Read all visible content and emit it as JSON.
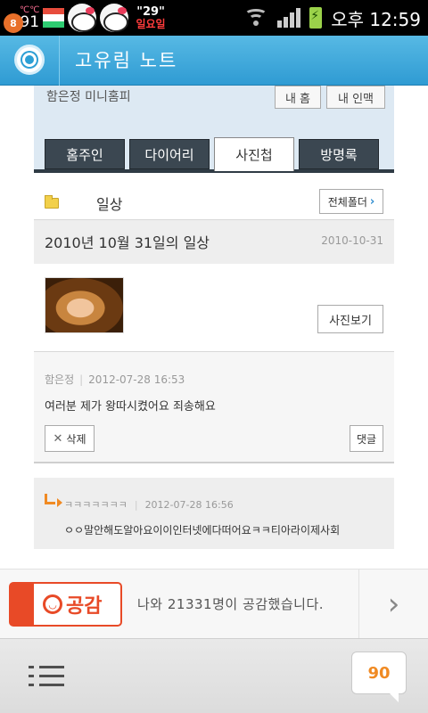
{
  "status_bar": {
    "badge_count": "8",
    "temp_small": "℃℃",
    "temp_value": "91",
    "weather_deg": "\"29\"",
    "weather_day": "일요일",
    "time": "오후 12:59",
    "icons": [
      "notification-badge-icon",
      "hello-kitty-icon",
      "wifi-icon",
      "signal-icon",
      "battery-charging-icon"
    ]
  },
  "app_bar": {
    "title": "고유림 노트",
    "accent": "#3aa7dc"
  },
  "profile": {
    "name": "함은정 미니홈피",
    "my_home": "내 홈",
    "my_network": "내 인맥"
  },
  "tabs": [
    {
      "label": "홈주인",
      "active": false
    },
    {
      "label": "다이어리",
      "active": false
    },
    {
      "label": "사진첩",
      "active": true
    },
    {
      "label": "방명록",
      "active": false
    }
  ],
  "folder": {
    "name": "일상",
    "all_folders_label": "전체폴더"
  },
  "post": {
    "title": "2010년 10월 31일의 일상",
    "date": "2010-10-31",
    "view_photo_label": "사진보기"
  },
  "comment": {
    "author": "함은정",
    "datetime": "2012-07-28 16:53",
    "text": "여러분 제가 왕따시켰어요 죄송해요",
    "delete_label": "삭제",
    "reply_label": "댓글"
  },
  "reply": {
    "author": "ㅋㅋㅋㅋㅋㅋㅋ",
    "datetime": "2012-07-28 16:56",
    "text": "ㅇㅇ말안해도알아요이이인터넷에다떠어요ㅋㅋ티아라이제사회"
  },
  "ad": {
    "logo_text": "공감",
    "message": "나와 21331명이 공감했습니다.",
    "brand_color": "#e84a27"
  },
  "bottom_bar": {
    "count": "90",
    "count_color": "#f08a23"
  }
}
